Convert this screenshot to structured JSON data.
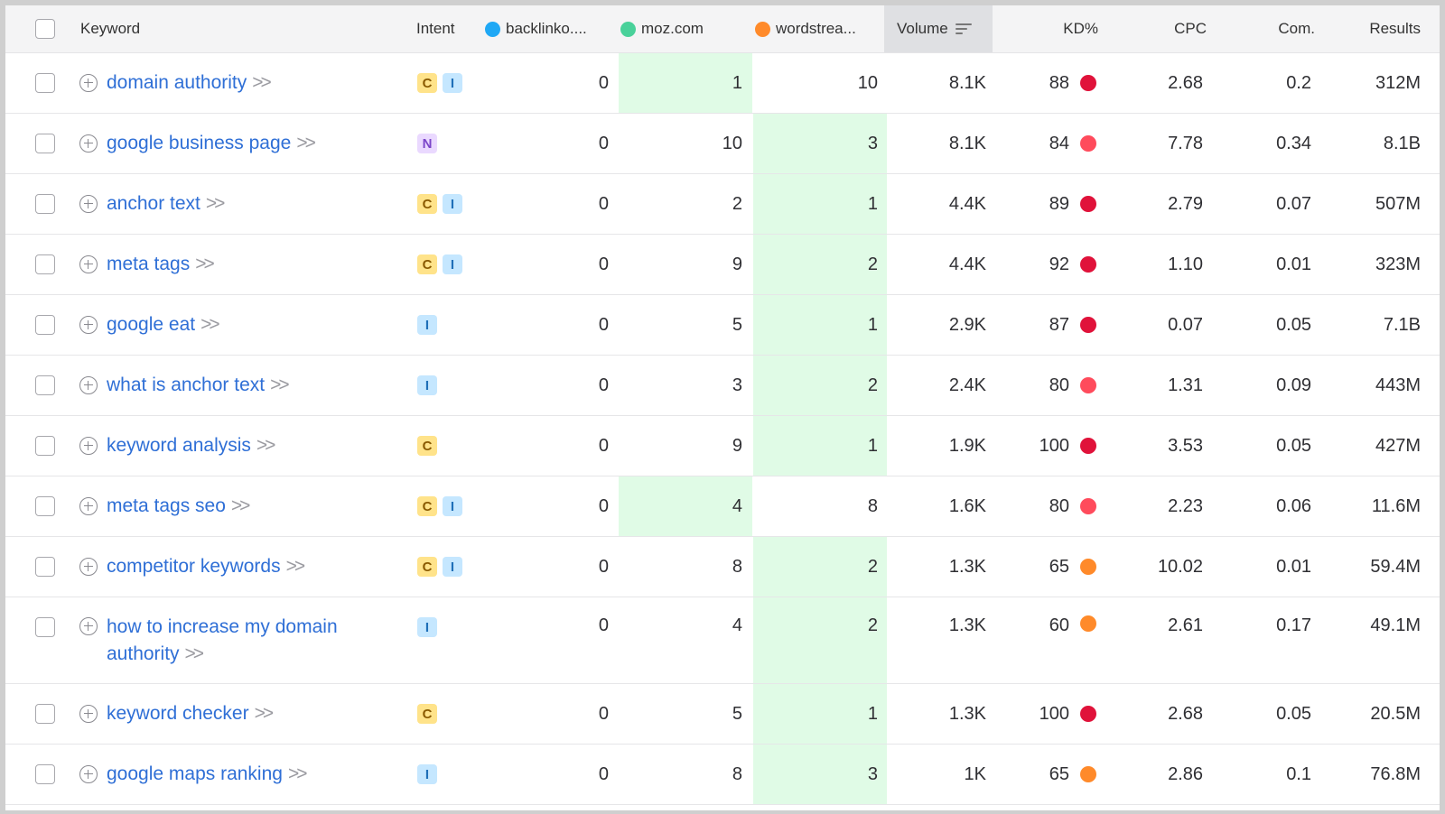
{
  "header": {
    "keyword": "Keyword",
    "intent": "Intent",
    "site1": "backlinko....",
    "site2": "moz.com",
    "site3": "wordstrea...",
    "volume": "Volume",
    "kd": "KD%",
    "cpc": "CPC",
    "com": "Com.",
    "results": "Results"
  },
  "colors": {
    "site1_dot": "#1fa8f5",
    "site2_dot": "#49d19a",
    "site3_dot": "#ff8a2a",
    "kd_very_hard": "#e0123a",
    "kd_hard": "#ff4b5c",
    "kd_medium": "#ff8a2a",
    "highlight": "#e0fbe6"
  },
  "rows": [
    {
      "keyword": "domain authority",
      "intent": [
        "C",
        "I"
      ],
      "backlinko": "0",
      "moz": "1",
      "wordstream": "10",
      "volume": "8.1K",
      "kd": "88",
      "kd_level": "very_hard",
      "cpc": "2.68",
      "com": "0.2",
      "results": "312M",
      "highlight": "moz"
    },
    {
      "keyword": "google business page",
      "intent": [
        "N"
      ],
      "backlinko": "0",
      "moz": "10",
      "wordstream": "3",
      "volume": "8.1K",
      "kd": "84",
      "kd_level": "hard",
      "cpc": "7.78",
      "com": "0.34",
      "results": "8.1B",
      "highlight": "wordstream"
    },
    {
      "keyword": "anchor text",
      "intent": [
        "C",
        "I"
      ],
      "backlinko": "0",
      "moz": "2",
      "wordstream": "1",
      "volume": "4.4K",
      "kd": "89",
      "kd_level": "very_hard",
      "cpc": "2.79",
      "com": "0.07",
      "results": "507M",
      "highlight": "wordstream"
    },
    {
      "keyword": "meta tags",
      "intent": [
        "C",
        "I"
      ],
      "backlinko": "0",
      "moz": "9",
      "wordstream": "2",
      "volume": "4.4K",
      "kd": "92",
      "kd_level": "very_hard",
      "cpc": "1.10",
      "com": "0.01",
      "results": "323M",
      "highlight": "wordstream"
    },
    {
      "keyword": "google eat",
      "intent": [
        "I"
      ],
      "backlinko": "0",
      "moz": "5",
      "wordstream": "1",
      "volume": "2.9K",
      "kd": "87",
      "kd_level": "very_hard",
      "cpc": "0.07",
      "com": "0.05",
      "results": "7.1B",
      "highlight": "wordstream"
    },
    {
      "keyword": "what is anchor text",
      "intent": [
        "I"
      ],
      "backlinko": "0",
      "moz": "3",
      "wordstream": "2",
      "volume": "2.4K",
      "kd": "80",
      "kd_level": "hard",
      "cpc": "1.31",
      "com": "0.09",
      "results": "443M",
      "highlight": "wordstream"
    },
    {
      "keyword": "keyword analysis",
      "intent": [
        "C"
      ],
      "backlinko": "0",
      "moz": "9",
      "wordstream": "1",
      "volume": "1.9K",
      "kd": "100",
      "kd_level": "very_hard",
      "cpc": "3.53",
      "com": "0.05",
      "results": "427M",
      "highlight": "wordstream"
    },
    {
      "keyword": "meta tags seo",
      "intent": [
        "C",
        "I"
      ],
      "backlinko": "0",
      "moz": "4",
      "wordstream": "8",
      "volume": "1.6K",
      "kd": "80",
      "kd_level": "hard",
      "cpc": "2.23",
      "com": "0.06",
      "results": "11.6M",
      "highlight": "moz"
    },
    {
      "keyword": "competitor keywords",
      "intent": [
        "C",
        "I"
      ],
      "backlinko": "0",
      "moz": "8",
      "wordstream": "2",
      "volume": "1.3K",
      "kd": "65",
      "kd_level": "medium",
      "cpc": "10.02",
      "com": "0.01",
      "results": "59.4M",
      "highlight": "wordstream"
    },
    {
      "keyword": "how to increase my domain authority",
      "keyword_line1": "how to increase my domain",
      "keyword_line2": "authority",
      "intent": [
        "I"
      ],
      "backlinko": "0",
      "moz": "4",
      "wordstream": "2",
      "volume": "1.3K",
      "kd": "60",
      "kd_level": "medium",
      "cpc": "2.61",
      "com": "0.17",
      "results": "49.1M",
      "highlight": "wordstream",
      "tall": true
    },
    {
      "keyword": "keyword checker",
      "intent": [
        "C"
      ],
      "backlinko": "0",
      "moz": "5",
      "wordstream": "1",
      "volume": "1.3K",
      "kd": "100",
      "kd_level": "very_hard",
      "cpc": "2.68",
      "com": "0.05",
      "results": "20.5M",
      "highlight": "wordstream"
    },
    {
      "keyword": "google maps ranking",
      "intent": [
        "I"
      ],
      "backlinko": "0",
      "moz": "8",
      "wordstream": "3",
      "volume": "1K",
      "kd": "65",
      "kd_level": "medium",
      "cpc": "2.86",
      "com": "0.1",
      "results": "76.8M",
      "highlight": "wordstream"
    }
  ]
}
